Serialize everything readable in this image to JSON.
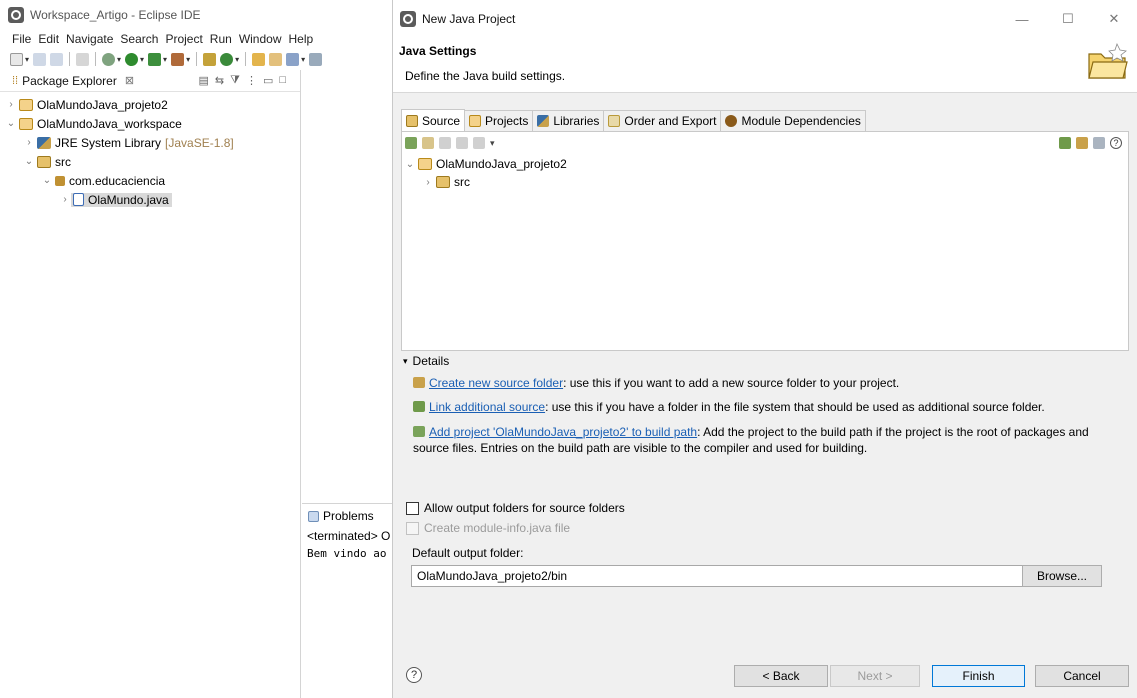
{
  "eclipse": {
    "title": "Workspace_Artigo - Eclipse IDE",
    "menu": [
      "File",
      "Edit",
      "Navigate",
      "Search",
      "Project",
      "Run",
      "Window",
      "Help"
    ],
    "package_explorer": {
      "tab_label": "Package Explorer",
      "close_glyph": "⊠",
      "tree": {
        "project1": "OlaMundoJava_projeto2",
        "project2": "OlaMundoJava_workspace",
        "jre": "JRE System Library",
        "jre_version": "[JavaSE-1.8]",
        "src": "src",
        "package": "com.educaciencia",
        "file": "OlaMundo.java"
      }
    },
    "problems": {
      "tab_label": "Problems",
      "terminated": "<terminated> O",
      "console_output": "Bem vindo ao"
    }
  },
  "dialog": {
    "title": "New Java Project",
    "banner_title": "Java Settings",
    "banner_desc": "Define the Java build settings.",
    "tabs": {
      "source": "Source",
      "projects": "Projects",
      "libraries": "Libraries",
      "order": "Order and Export",
      "modules": "Module Dependencies"
    },
    "source_tree": {
      "project": "OlaMundoJava_projeto2",
      "src": "src"
    },
    "details": {
      "header": "Details",
      "item1_link": "Create new source folder",
      "item1_text": ": use this if you want to add a new source folder to your project.",
      "item2_link": "Link additional source",
      "item2_text": ": use this if you have a folder in the file system that should be used as additional source folder.",
      "item3_link": "Add project 'OlaMundoJava_projeto2' to build path",
      "item3_text": ": Add the project to the build path if the project is the root of packages and source files. Entries on the build path are visible to the compiler and used for building."
    },
    "options": {
      "allow_output": "Allow output folders for source folders",
      "create_module": "Create module-info.java file",
      "default_output_label": "Default output folder:",
      "default_output_value": "OlaMundoJava_projeto2/bin",
      "browse": "Browse..."
    },
    "buttons": {
      "back": "< Back",
      "next": "Next >",
      "finish": "Finish",
      "cancel": "Cancel",
      "help": "?"
    },
    "window_buttons": {
      "minimize": "—",
      "maximize": "☐",
      "close": "✕"
    }
  }
}
